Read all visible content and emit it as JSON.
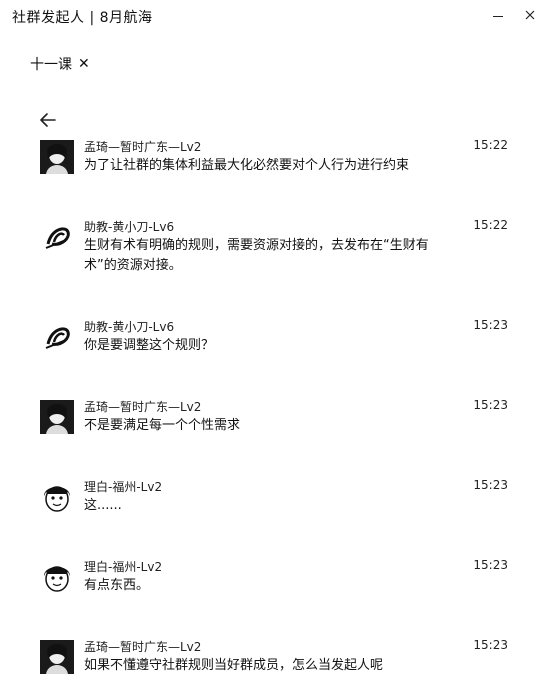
{
  "window": {
    "title": "社群发起人 | 8月航海"
  },
  "tag": {
    "label": "十一课",
    "close_glyph": "✕"
  },
  "messages": [
    {
      "name": "孟琦—暂时广东—Lv2",
      "time": "15:22",
      "text": "为了让社群的集体利益最大化必然要对个人行为进行约束",
      "avatar": "woman-photo"
    },
    {
      "name": "助教-黄小刀-Lv6",
      "time": "15:22",
      "text": "生财有术有明确的规则，需要资源对接的，去发布在“生财有术”的资源对接。",
      "avatar": "logo"
    },
    {
      "name": "助教-黄小刀-Lv6",
      "time": "15:23",
      "text": "你是要调整这个规则？",
      "avatar": "logo"
    },
    {
      "name": "孟琦—暂时广东—Lv2",
      "time": "15:23",
      "text": "不是要满足每一个个性需求",
      "avatar": "woman-photo"
    },
    {
      "name": "理白-福州-Lv2",
      "time": "15:23",
      "text": "这......",
      "avatar": "cartoon-face"
    },
    {
      "name": "理白-福州-Lv2",
      "time": "15:23",
      "text": "有点东西。",
      "avatar": "cartoon-face"
    },
    {
      "name": "孟琦—暂时广东—Lv2",
      "time": "15:23",
      "text": "如果不懂遵守社群规则当好群成员，怎么当发起人呢",
      "avatar": "woman-photo"
    }
  ]
}
